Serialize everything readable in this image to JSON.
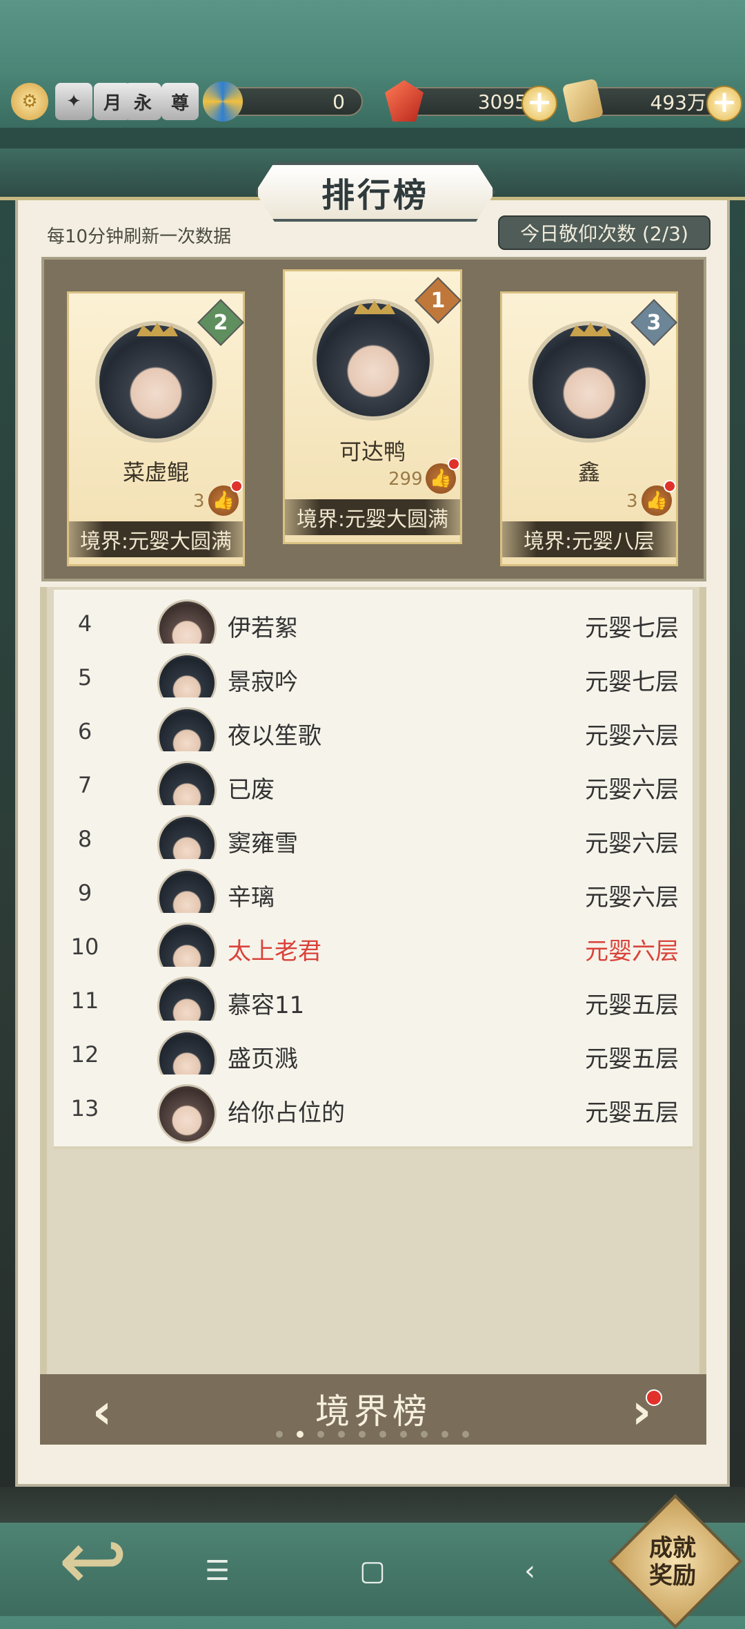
{
  "hud": {
    "icons": [
      "settings-icon",
      "badge-icon",
      "moon-badge-icon",
      "eternal-badge-icon",
      "supreme-badge-icon"
    ],
    "icon_glyphs": {
      "moon": "月",
      "eternal": "永",
      "supreme": "尊"
    },
    "spirit_value": "0",
    "gem_value": "3095",
    "scroll_value": "493万"
  },
  "panel": {
    "title": "排行榜",
    "refresh_note": "每10分钟刷新一次数据",
    "worship_count": "今日敬仰次数 (2/3)"
  },
  "podium": [
    {
      "rank": "2",
      "name": "菜虚鲲",
      "likes": "3",
      "realm": "境界:元婴大圆满"
    },
    {
      "rank": "1",
      "name": "可达鸭",
      "likes": "299",
      "realm": "境界:元婴大圆满"
    },
    {
      "rank": "3",
      "name": "鑫",
      "likes": "3",
      "realm": "境界:元婴八层"
    }
  ],
  "ranking": [
    {
      "rank": "4",
      "name": "伊若絮",
      "realm": "元婴七层",
      "avatar": "female"
    },
    {
      "rank": "5",
      "name": "景寂吟",
      "realm": "元婴七层",
      "avatar": "male"
    },
    {
      "rank": "6",
      "name": "夜以笙歌",
      "realm": "元婴六层",
      "avatar": "male"
    },
    {
      "rank": "7",
      "name": "已废",
      "realm": "元婴六层",
      "avatar": "male"
    },
    {
      "rank": "8",
      "name": "窦雍雪",
      "realm": "元婴六层",
      "avatar": "male"
    },
    {
      "rank": "9",
      "name": "辛璃",
      "realm": "元婴六层",
      "avatar": "male"
    },
    {
      "rank": "10",
      "name": "太上老君",
      "realm": "元婴六层",
      "avatar": "male",
      "highlight": true
    },
    {
      "rank": "11",
      "name": "慕容11",
      "realm": "元婴五层",
      "avatar": "male"
    },
    {
      "rank": "12",
      "name": "盛页溅",
      "realm": "元婴五层",
      "avatar": "male"
    },
    {
      "rank": "13",
      "name": "给你占位的",
      "realm": "元婴五层",
      "avatar": "female"
    }
  ],
  "footer": {
    "title": "境界榜",
    "page_count": 10,
    "active_page": 2
  },
  "bottom": {
    "achievement_line1": "成就",
    "achievement_line2": "奖励",
    "system_nav": [
      "menu-icon",
      "home-icon",
      "back-icon"
    ]
  },
  "colors": {
    "highlight": "#d9423a",
    "rank1": "#c0783a",
    "rank2": "#5f8f5e",
    "rank3": "#6c8597"
  }
}
